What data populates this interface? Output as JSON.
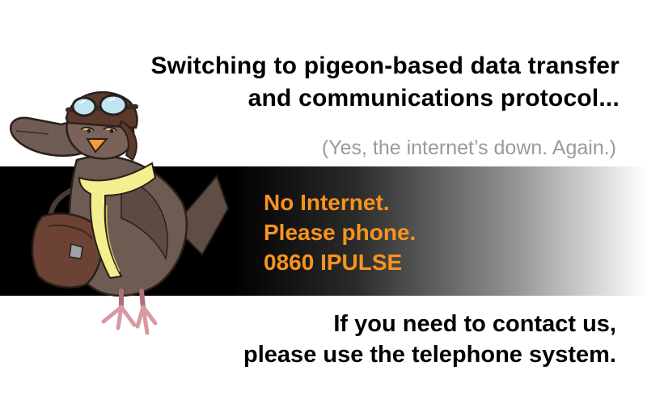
{
  "headline": {
    "line1": "Switching to pigeon-based data transfer",
    "line2": "and communications protocol..."
  },
  "subnote": "(Yes, the internet’s down. Again.)",
  "notice": {
    "line1": "No Internet.",
    "line2": "Please phone.",
    "line3": "0860 IPULSE"
  },
  "footer": {
    "line1": "If you need to contact us,",
    "line2": "please use the telephone system."
  },
  "illustration": {
    "subject": "saluting pigeon with aviator goggles, scarf and messenger bag",
    "icon": "pigeon-icon"
  },
  "colors": {
    "accent": "#f7941d",
    "band_dark": "#000000",
    "subnote_gray": "#9a9a9a",
    "pigeon_body": "#6e5b52",
    "scarf": "#f3ef8e"
  }
}
